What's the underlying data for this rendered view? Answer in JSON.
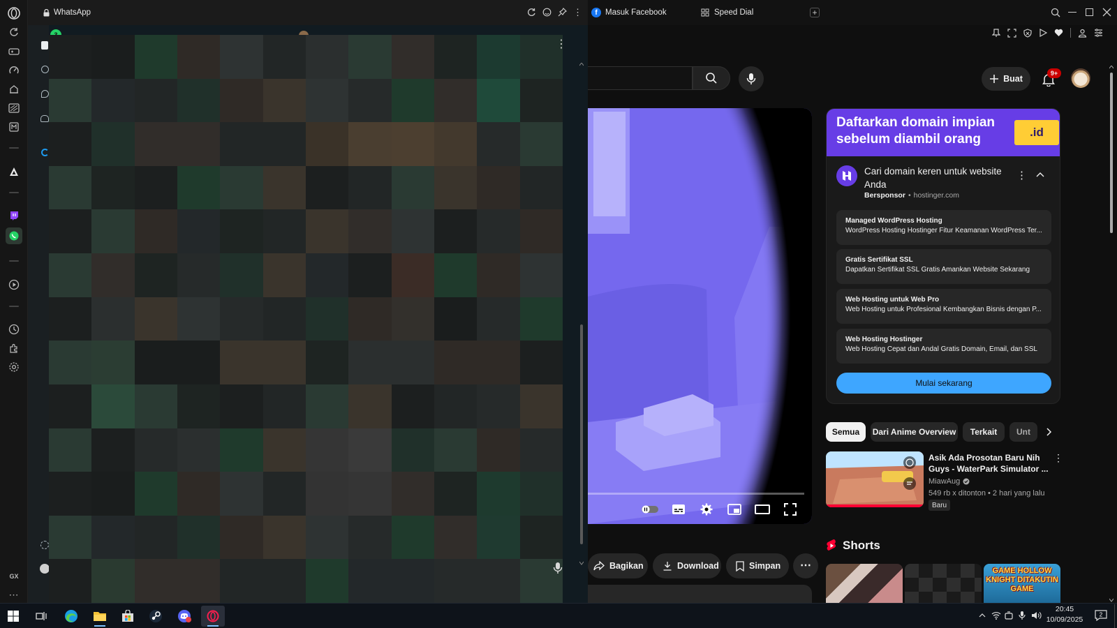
{
  "browser": {
    "panel_title": "WhatsApp",
    "tabs": [
      {
        "label": "Masuk Facebook"
      },
      {
        "label": "Speed Dial"
      }
    ],
    "sidebar_label_gx": "GX"
  },
  "whatsapp": {
    "unread_count": "3"
  },
  "youtube": {
    "create_label": "Buat",
    "notification_badge": "9+",
    "actions": {
      "share": "Bagikan",
      "download": "Download",
      "save": "Simpan"
    },
    "ad": {
      "banner_text": "Daftarkan domain impian sebelum diambil orang",
      "banner_pill": ".id",
      "headline": "Cari domain keren untuk website Anda",
      "sponsored_label": "Bersponsor",
      "domain": "hostinger.com",
      "sitelinks": [
        {
          "title": "Managed WordPress Hosting",
          "description": "WordPress Hosting Hostinger Fitur Keamanan WordPress Ter..."
        },
        {
          "title": "Gratis Sertifikat SSL",
          "description": "Dapatkan Sertifikat SSL Gratis Amankan Website Sekarang"
        },
        {
          "title": "Web Hosting untuk Web Pro",
          "description": "Web Hosting untuk Profesional Kembangkan Bisnis dengan P..."
        },
        {
          "title": "Web Hosting Hostinger",
          "description": "Web Hosting Cepat dan Andal Gratis Domain, Email, dan SSL"
        }
      ],
      "cta": "Mulai sekarang"
    },
    "chips": [
      {
        "label": "Semua",
        "active": true
      },
      {
        "label": "Dari Anime Overview",
        "active": false
      },
      {
        "label": "Terkait",
        "active": false
      },
      {
        "label": "Unt",
        "active": false
      }
    ],
    "recommendation": {
      "title": "Asik Ada Prosotan Baru Nih Guys - WaterPark Simulator ...",
      "channel": "MiawAug",
      "meta": "549 rb x ditonton • 2 hari yang lalu",
      "badge": "Baru"
    },
    "shorts_title": "Shorts",
    "short_thumb_text": "GAME HOLLOW KNIGHT DITAKUTIN GAME"
  },
  "taskbar": {
    "time": "20:45",
    "date": "10/09/2025",
    "notifications": "2"
  },
  "colors": {
    "youtube_red": "#ff0033",
    "whatsapp_green": "#25d366",
    "hostinger_purple": "#673de6",
    "cta_blue": "#3ea6ff"
  },
  "icons": [
    "opera-logo-icon",
    "reload-icon",
    "snapshot-icon",
    "pin-icon",
    "search-icon",
    "mic-icon",
    "bell-icon",
    "plus-icon",
    "share-icon",
    "download-icon",
    "bookmark-icon",
    "settings-icon",
    "fullscreen-icon",
    "windows-start-icon"
  ]
}
